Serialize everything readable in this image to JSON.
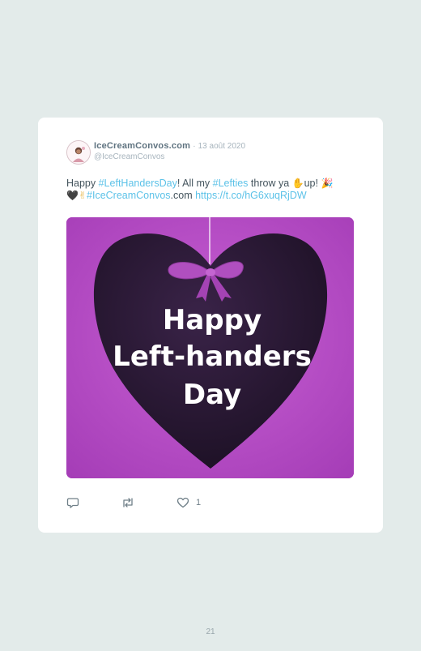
{
  "tweet": {
    "display_name": "IceCreamConvos.com",
    "date": "13 août 2020",
    "date_separator": "·",
    "handle": "@IceCreamConvos",
    "text": {
      "t1": "Happy ",
      "hashtag1": "#LeftHandersDay",
      "t2": "! All my ",
      "hashtag2": "#Lefties",
      "t3": " throw ya ",
      "emoji1": "✋",
      "t4": "up! ",
      "emoji2": "🎉",
      "emoji3": "🖤",
      "emoji4": "✌",
      "hashtag3": "#IceCreamConvos",
      "t5": ".com ",
      "link": "https://t.co/hG6xuqRjDW"
    },
    "media": {
      "heart_text": [
        "Happy",
        "Left-handers",
        "Day"
      ]
    },
    "actions": {
      "reply_icon": "reply-icon",
      "retweet_icon": "retweet-icon",
      "like_icon": "heart-icon",
      "like_count": "1"
    }
  },
  "page": {
    "number": "21"
  },
  "colors": {
    "background": "#e3ebea",
    "card": "#ffffff",
    "link": "#5cc2e8",
    "name": "#5f7380",
    "muted": "#a7b4bd",
    "media_bg": "#b345c0",
    "heart": "#241530",
    "ribbon": "#b04fbf"
  }
}
